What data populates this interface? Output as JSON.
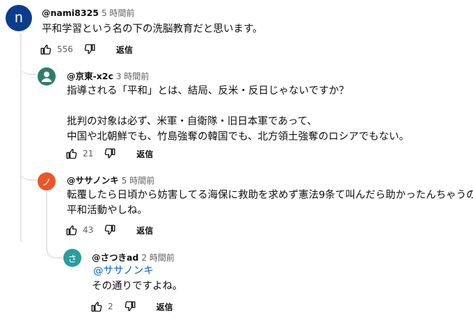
{
  "comments": [
    {
      "avatar_letter": "n",
      "avatar_color": "#0b3d8c",
      "author": "@nami8325",
      "time": "5 時間前",
      "lines": [
        "平和学習という名の下の洗脳教育だと思います。"
      ],
      "likes": "556",
      "reply_label": "返信"
    },
    {
      "avatar_icon": "person-icon",
      "avatar_color": "#2e7d6b",
      "author": "@京東-x2c",
      "time": "3 時間前",
      "lines": [
        "指導される「平和」とは、結局、反米・反日じゃないですか？",
        "",
        "批判の対象は必ず、米軍・自衛隊・旧日本軍であって、",
        "中国や北朝鮮でも、竹島強奪の韓国でも、北方領土強奪のロシアでもない。"
      ],
      "likes": "21",
      "reply_label": "返信"
    },
    {
      "avatar_letter": "ノ",
      "avatar_color": "#e8572a",
      "author": "@ササノンキ",
      "time": "5 時間前",
      "lines": [
        "転覆したら日頃から妨害してる海保に救助を求めず憲法9条て叫んだら助かったんちゃうの。",
        "平和活動やしね。"
      ],
      "likes": "43",
      "reply_label": "返信"
    },
    {
      "avatar_letter": "さ",
      "avatar_color": "#2a9d9f",
      "author": "@さつきad",
      "time": "2 時間前",
      "mention": "@ササノンキ",
      "lines": [
        "その通りですよね。"
      ],
      "likes": "2",
      "reply_label": "返信"
    }
  ]
}
